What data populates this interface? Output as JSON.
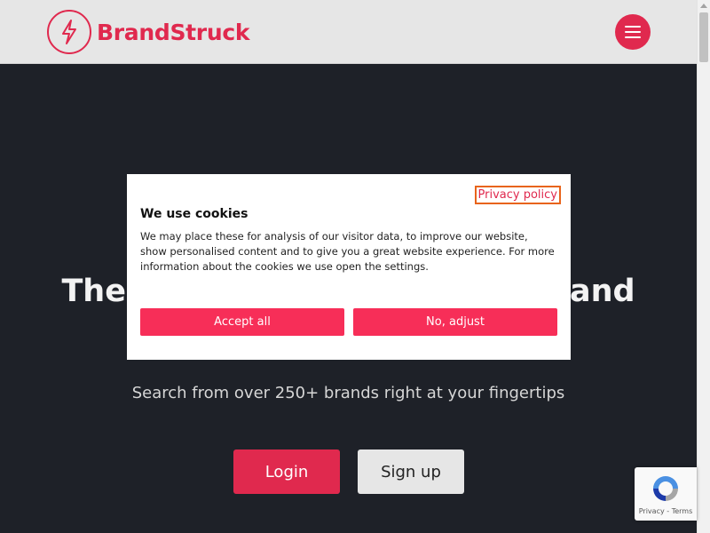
{
  "header": {
    "brand": "BrandStruck",
    "brand_color": "#e0294e"
  },
  "hero": {
    "title_left": "The",
    "title_right": "and",
    "subtitle": "Search from over 250+ brands right at your fingertips",
    "login_label": "Login",
    "signup_label": "Sign up"
  },
  "cookie": {
    "privacy_link": "Privacy policy",
    "title": "We use cookies",
    "text": "We may place these for analysis of our visitor data, to improve our website, show personalised content and to give you a great website experience. For more information about the cookies we use open the settings.",
    "accept_label": "Accept all",
    "adjust_label": "No, adjust"
  },
  "recaptcha": {
    "privacy": "Privacy",
    "separator": " - ",
    "terms": "Terms"
  },
  "icons": {
    "logo": "lightning-bolt-icon",
    "menu": "hamburger-menu-icon",
    "captcha": "recaptcha-icon"
  }
}
